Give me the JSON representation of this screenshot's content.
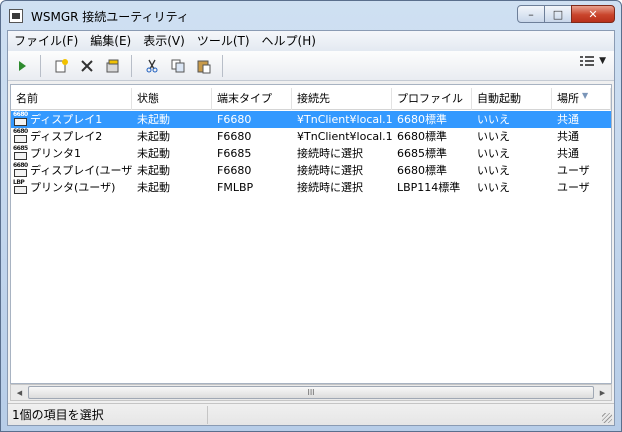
{
  "window": {
    "title": "WSMGR 接続ユーティリティ",
    "buttons": {
      "minimize": "–",
      "maximize": "□",
      "close": "✕"
    }
  },
  "menu": [
    {
      "label": "ファイル(F)"
    },
    {
      "label": "編集(E)"
    },
    {
      "label": "表示(V)"
    },
    {
      "label": "ツール(T)"
    },
    {
      "label": "ヘルプ(H)"
    }
  ],
  "toolbar": {
    "icons": [
      "play-icon",
      "new-icon",
      "delete-icon",
      "properties-icon",
      "cut-icon",
      "copy-icon",
      "paste-icon",
      "view-list-icon"
    ]
  },
  "list": {
    "columns": [
      "名前",
      "状態",
      "端末タイプ",
      "接続先",
      "プロファイル",
      "自動起動",
      "場所"
    ],
    "rows": [
      {
        "icon_label": "6680",
        "name": "ディスプレイ1",
        "status": "未起動",
        "terminal": "F6680",
        "dest": "¥TnClient¥local.1",
        "profile": "6680標準",
        "auto": "いいえ",
        "place": "共通",
        "selected": true
      },
      {
        "icon_label": "6680",
        "name": "ディスプレイ2",
        "status": "未起動",
        "terminal": "F6680",
        "dest": "¥TnClient¥local.1",
        "profile": "6680標準",
        "auto": "いいえ",
        "place": "共通",
        "selected": false
      },
      {
        "icon_label": "6685",
        "name": "プリンタ1",
        "status": "未起動",
        "terminal": "F6685",
        "dest": "接続時に選択",
        "profile": "6685標準",
        "auto": "いいえ",
        "place": "共通",
        "selected": false
      },
      {
        "icon_label": "6680",
        "name": "ディスプレイ(ユーザ)",
        "status": "未起動",
        "terminal": "F6680",
        "dest": "接続時に選択",
        "profile": "6680標準",
        "auto": "いいえ",
        "place": "ユーザ",
        "selected": false
      },
      {
        "icon_label": "LBP",
        "name": "プリンタ(ユーザ)",
        "status": "未起動",
        "terminal": "FMLBP",
        "dest": "接続時に選択",
        "profile": "LBP114標準",
        "auto": "いいえ",
        "place": "ユーザ",
        "selected": false
      }
    ]
  },
  "scrollbar": {
    "thumb_grip": "III"
  },
  "status_bar": {
    "text": "1個の項目を選択"
  },
  "colors": {
    "selection": "#3399ff",
    "title_bg": "#c4d7ee",
    "close_button": "#c9452c"
  }
}
